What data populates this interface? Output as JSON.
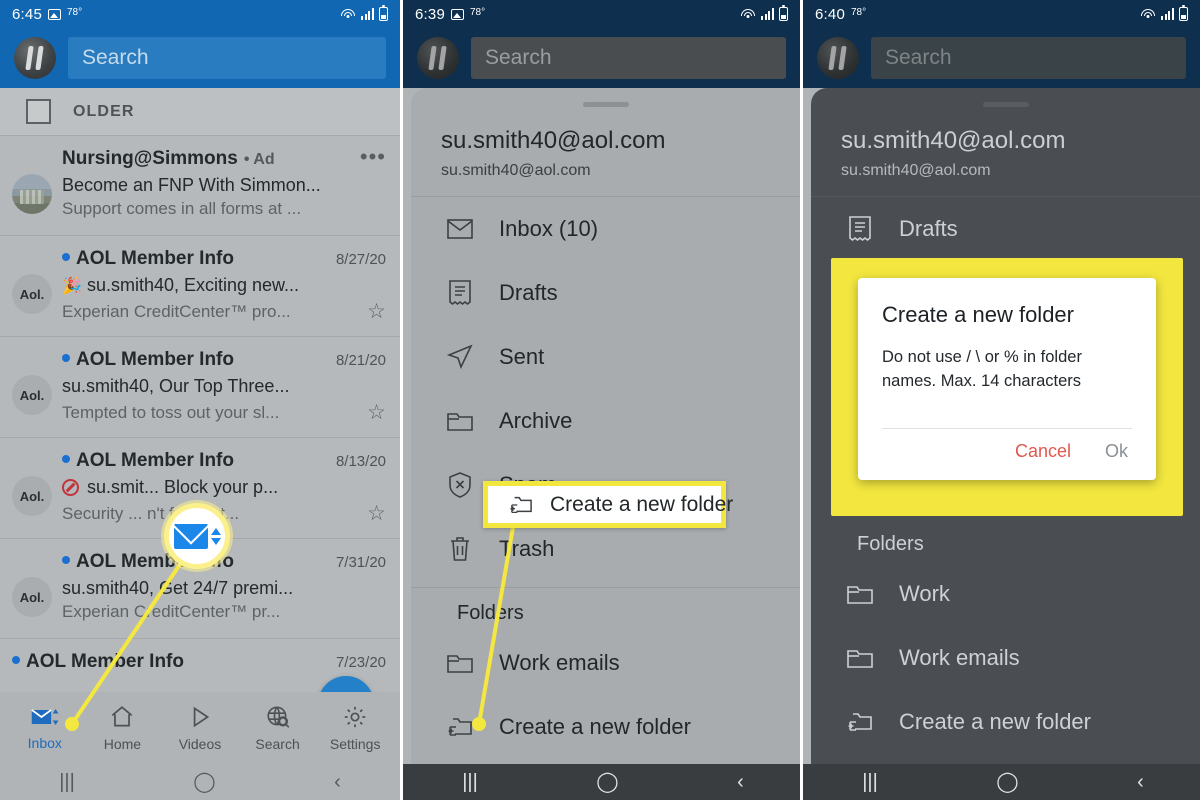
{
  "panels": [
    {
      "id": "inbox-list",
      "status": {
        "time": "6:45",
        "temp": "78°",
        "has_photo_icon": true
      },
      "search_placeholder": "Search",
      "list_header": {
        "label": "OLDER"
      },
      "emails": [
        {
          "sender": "Nursing@Simmons",
          "ad_tag": "• Ad",
          "date": "",
          "subject": "Become an FNP With Simmon...",
          "snippet": "Support comes in all forms at ...",
          "unread": false,
          "avatar_text": "",
          "avatar_kind": "photo",
          "starred": false,
          "has_menu": true,
          "emoji": ""
        },
        {
          "sender": "AOL Member Info",
          "ad_tag": "",
          "date": "8/27/20",
          "subject": "su.smith40, Exciting new...",
          "snippet": "Experian CreditCenter™ pro...",
          "unread": true,
          "avatar_text": "Aol.",
          "avatar_kind": "text",
          "starred": true,
          "has_menu": false,
          "emoji": "🎉"
        },
        {
          "sender": "AOL Member Info",
          "ad_tag": "",
          "date": "8/21/20",
          "subject": "su.smith40, Our Top Three...",
          "snippet": "Tempted to toss out your sl...",
          "unread": true,
          "avatar_text": "Aol.",
          "avatar_kind": "text",
          "starred": true,
          "has_menu": false,
          "emoji": ""
        },
        {
          "sender": "AOL Member Info",
          "ad_tag": "",
          "date": "8/13/20",
          "subject": "su.smit... Block your p...",
          "snippet": "Security ... n't fall for t...",
          "unread": true,
          "avatar_text": "Aol.",
          "avatar_kind": "text",
          "starred": true,
          "has_menu": false,
          "emoji": "no-entry"
        },
        {
          "sender": "AOL Member Info",
          "ad_tag": "",
          "date": "7/31/20",
          "subject": "su.smith40, Get 24/7 premi...",
          "snippet": "Experian CreditCenter™ pr...",
          "unread": true,
          "avatar_text": "Aol.",
          "avatar_kind": "text",
          "starred": false,
          "has_menu": false,
          "emoji": ""
        },
        {
          "sender": "AOL Member Info",
          "ad_tag": "",
          "date": "7/23/20",
          "subject": "",
          "snippet": "",
          "unread": true,
          "avatar_text": "",
          "avatar_kind": "none",
          "starred": false,
          "has_menu": false,
          "emoji": ""
        }
      ],
      "tabs": [
        {
          "label": "Inbox",
          "icon": "inbox-envelope-icon",
          "active": true
        },
        {
          "label": "Home",
          "icon": "home-icon",
          "active": false
        },
        {
          "label": "Videos",
          "icon": "videos-play-icon",
          "active": false
        },
        {
          "label": "Search",
          "icon": "search-globe-icon",
          "active": false
        },
        {
          "label": "Settings",
          "icon": "gear-icon",
          "active": false
        }
      ],
      "compose_fab": "compose-pencil-icon"
    },
    {
      "id": "drawer-open",
      "status": {
        "time": "6:39",
        "temp": "78°",
        "has_photo_icon": true
      },
      "search_placeholder": "Search",
      "account": {
        "name": "su.smith40@aol.com",
        "email": "su.smith40@aol.com"
      },
      "folders_primary": [
        {
          "label": "Inbox (10)",
          "icon": "envelope-icon"
        },
        {
          "label": "Drafts",
          "icon": "drafts-icon"
        },
        {
          "label": "Sent",
          "icon": "sent-paperplane-icon"
        },
        {
          "label": "Archive",
          "icon": "archive-folder-icon"
        },
        {
          "label": "Spam",
          "icon": "spam-shield-icon"
        },
        {
          "label": "Trash",
          "icon": "trash-icon"
        }
      ],
      "section_label": "Folders",
      "folders_custom": [
        {
          "label": "Work emails",
          "icon": "folder-icon"
        },
        {
          "label": "Create a new folder",
          "icon": "new-folder-icon"
        }
      ],
      "callout": {
        "label": "Create a new folder",
        "icon": "new-folder-icon"
      }
    },
    {
      "id": "create-folder-dialog",
      "status": {
        "time": "6:40",
        "temp": "78°",
        "has_photo_icon": false
      },
      "search_placeholder": "Search",
      "account": {
        "name": "su.smith40@aol.com",
        "email": "su.smith40@aol.com"
      },
      "folders_primary": [
        {
          "label": "Drafts",
          "icon": "drafts-icon"
        }
      ],
      "section_label": "Folders",
      "folders_custom": [
        {
          "label": "Work",
          "icon": "folder-icon"
        },
        {
          "label": "Work emails",
          "icon": "folder-icon"
        },
        {
          "label": "Create a new folder",
          "icon": "new-folder-icon"
        }
      ],
      "dialog": {
        "title": "Create a new folder",
        "body": "Do not use / \\ or % in folder names. Max. 14 characters",
        "cancel_label": "Cancel",
        "ok_label": "Ok"
      }
    }
  ],
  "navbar": {
    "recents": "|||",
    "home": "◯",
    "back": "‹"
  },
  "colors": {
    "header_blue_light": "#1167b1",
    "header_blue_dark": "#0e2f4d",
    "highlight_yellow": "#f2e63f",
    "accent_blue": "#2481c9",
    "cancel_red": "#e0584f"
  }
}
